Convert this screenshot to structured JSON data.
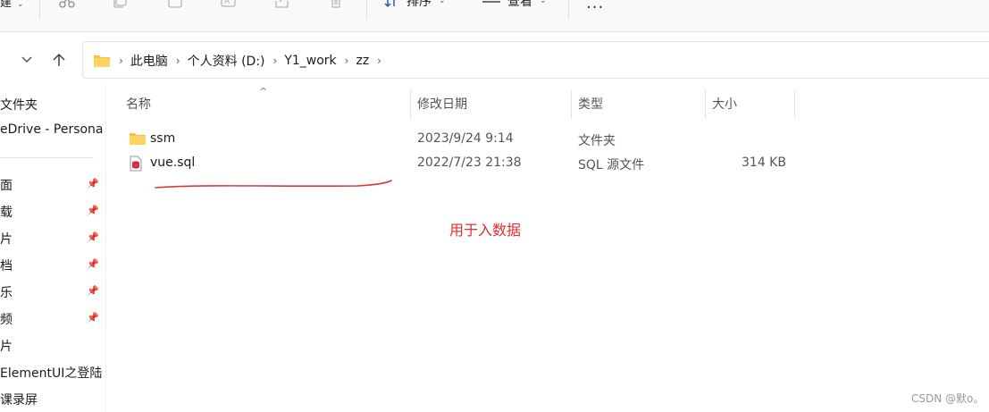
{
  "toolbar": {
    "partial_label": "建",
    "sort_label": "排序",
    "view_label": "查看",
    "more_label": "···"
  },
  "address": {
    "crumbs": [
      "此电脑",
      "个人资料 (D:)",
      "Y1_work",
      "zz"
    ]
  },
  "sidebar": {
    "items": [
      {
        "label": "文件夹",
        "pinned": false
      },
      {
        "label": "eDrive - Persona",
        "pinned": false
      },
      {
        "label": "面",
        "pinned": true
      },
      {
        "label": "载",
        "pinned": true
      },
      {
        "label": "片",
        "pinned": true
      },
      {
        "label": "档",
        "pinned": true
      },
      {
        "label": "乐",
        "pinned": true
      },
      {
        "label": "频",
        "pinned": true
      },
      {
        "label": "片",
        "pinned": false
      },
      {
        "label": "ElementUI之登陆",
        "pinned": false
      },
      {
        "label": "课录屏",
        "pinned": false
      }
    ]
  },
  "columns": {
    "name": "名称",
    "modified": "修改日期",
    "type": "类型",
    "size": "大小"
  },
  "files": [
    {
      "name": "ssm",
      "modified": "2023/9/24 9:14",
      "type": "文件夹",
      "size": "",
      "icon": "folder-icon"
    },
    {
      "name": "vue.sql",
      "modified": "2022/7/23 21:38",
      "type": "SQL 源文件",
      "size": "314 KB",
      "icon": "sql-file-icon"
    }
  ],
  "annotation": "用于入数据",
  "watermark": "CSDN @默o。",
  "colors": {
    "folder": "#f5c242",
    "annotation": "#e03030",
    "sql_icon": "#c8324a"
  }
}
